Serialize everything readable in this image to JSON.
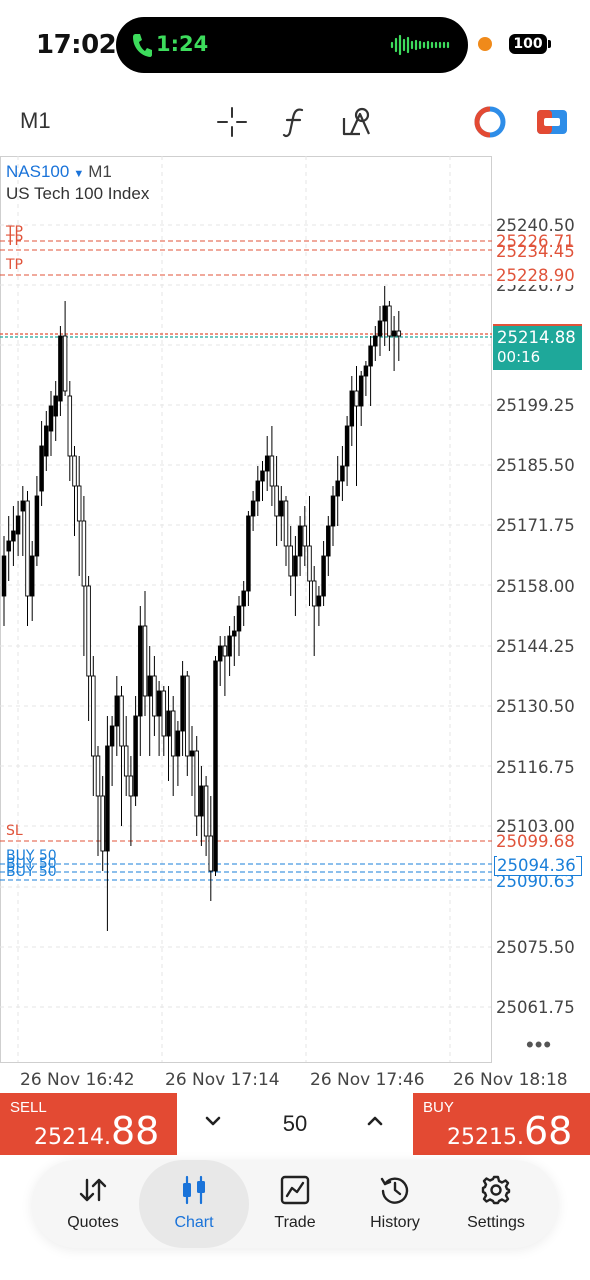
{
  "status_bar": {
    "time": "17:02",
    "call_time": "1:24",
    "battery": "100"
  },
  "toolbar": {
    "timeframe": "M1"
  },
  "chart": {
    "symbol": "NAS100",
    "symbol_timeframe": "M1",
    "description": "US Tech 100 Index",
    "current_price": "25214.88",
    "countdown": "00:16",
    "price_axis": [
      "25240.50",
      "25226.71",
      "25234.45",
      "25228.90",
      "25226.75",
      "25199.25",
      "25185.50",
      "25171.75",
      "25158.00",
      "25144.25",
      "25130.50",
      "25116.75",
      "25103.00",
      "25099.68",
      "25094.36",
      "25090.63",
      "25075.50",
      "25061.75"
    ],
    "line_tags": {
      "tp": "TP",
      "sl": "SL",
      "buy": "BUY 50"
    },
    "time_axis": [
      "26 Nov 16:42",
      "26 Nov 17:14",
      "26 Nov 17:46",
      "26 Nov 18:18"
    ],
    "more": "•••",
    "colors": {
      "bull": "#000000",
      "bear": "#ffffff",
      "tp_sl": "#e0533a",
      "buy": "#1a7fd9",
      "current": "#1ea89a"
    }
  },
  "trade": {
    "sell_label": "SELL",
    "sell_price_main": "25214.",
    "sell_price_big": "88",
    "volume": "50",
    "buy_label": "BUY",
    "buy_price_main": "25215.",
    "buy_price_big": "68"
  },
  "nav": {
    "quotes": "Quotes",
    "chart": "Chart",
    "trade": "Trade",
    "history": "History",
    "settings": "Settings"
  }
}
